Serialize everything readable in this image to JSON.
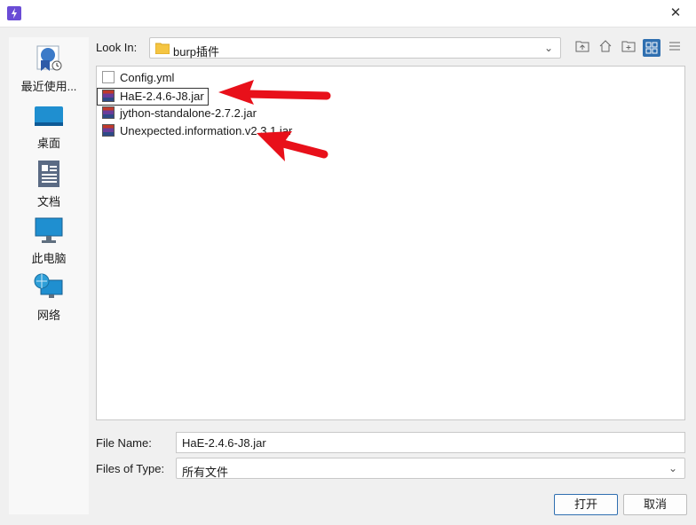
{
  "window": {
    "close_glyph": "✕"
  },
  "places": [
    {
      "label": "最近使用..."
    },
    {
      "label": "桌面"
    },
    {
      "label": "文档"
    },
    {
      "label": "此电脑"
    },
    {
      "label": "网络"
    }
  ],
  "look_in": {
    "label": "Look In:",
    "value": "burp插件"
  },
  "files": [
    {
      "name": "Config.yml",
      "icon": "text-file-icon"
    },
    {
      "name": "HaE-2.4.6-J8.jar",
      "icon": "jar-file-icon"
    },
    {
      "name": "jython-standalone-2.7.2.jar",
      "icon": "jar-file-icon"
    },
    {
      "name": "Unexpected.information.v2.3.1.jar",
      "icon": "jar-file-icon"
    }
  ],
  "file_name": {
    "label": "File Name:",
    "value": "HaE-2.4.6-J8.jar"
  },
  "file_type": {
    "label": "Files of Type:",
    "value": "所有文件"
  },
  "buttons": {
    "open": "打开",
    "cancel": "取消"
  },
  "colors": {
    "accent": "#2f6fb0",
    "annotation_arrow": "#e8101a"
  }
}
